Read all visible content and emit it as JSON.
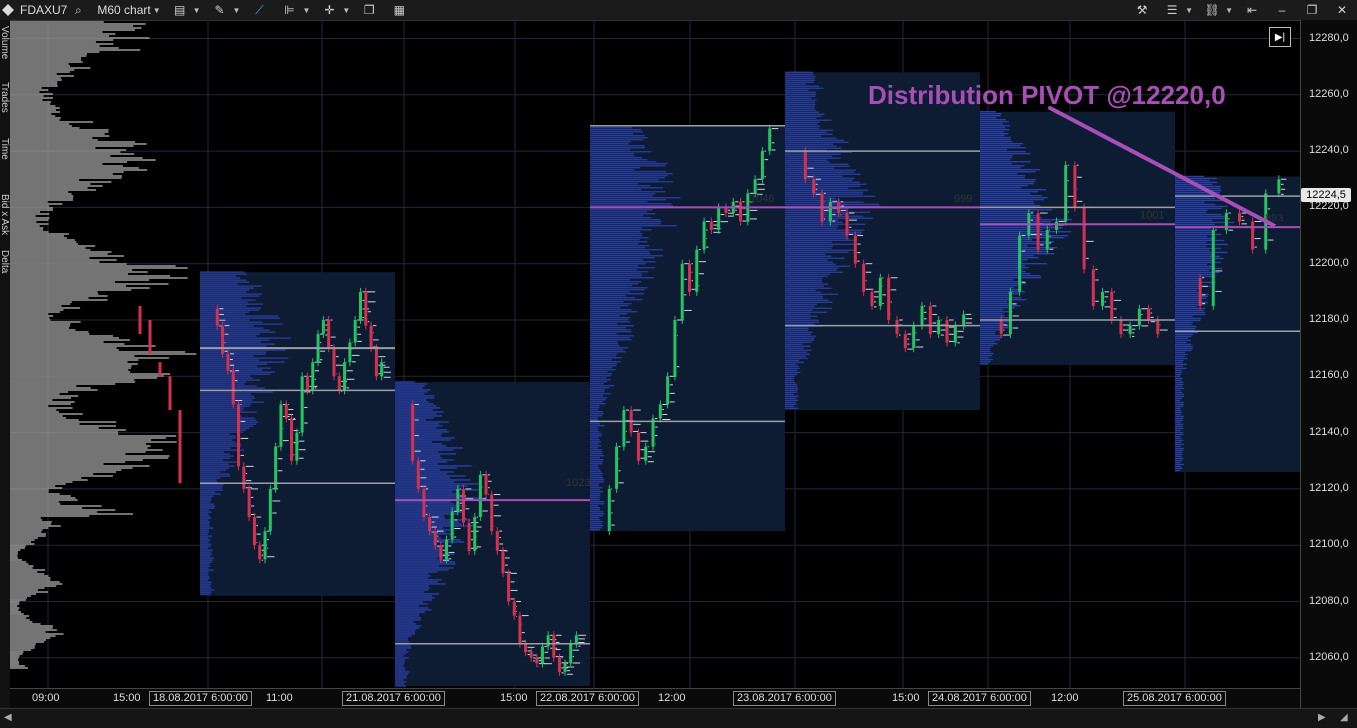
{
  "toolbar": {
    "symbol": "FDAXU7",
    "timeframe": "M60 chart",
    "icons": [
      "search-icon",
      "chart-type-icon",
      "pencil-icon",
      "line-chart-icon",
      "indicators-icon",
      "crosshair-icon",
      "window-icon",
      "template-icon"
    ],
    "right_icons": [
      "tools-icon",
      "layout-icon",
      "link-icon",
      "pin-icon",
      "restore-icon",
      "close-icon"
    ]
  },
  "left_strip_labels": [
    "Volume",
    "Trades",
    "Time",
    "Bid x Ask",
    "Delta"
  ],
  "colors": {
    "bull": "#22c55e",
    "bear": "#d6304f",
    "profile": "#2b3fa8",
    "profile_bg": "#0d1c33",
    "poc": "#9aa0a6",
    "vpoc": "#a74fb6",
    "annotation": "#a74fb6"
  },
  "y_axis": {
    "labels": [
      "12280,0",
      "12260,0",
      "12240,0",
      "12220,0",
      "12200,0",
      "12180,0",
      "12160,0",
      "12140,0",
      "12120,0",
      "12100,0",
      "12080,0",
      "12060,0"
    ],
    "current_price": "12224,5"
  },
  "x_axis": {
    "labels": [
      {
        "text": "09:00",
        "boxed": false
      },
      {
        "text": "15:00",
        "boxed": false
      },
      {
        "text": "18.08.2017 6:00:00",
        "boxed": true
      },
      {
        "text": "11:00",
        "boxed": false
      },
      {
        "text": "21.08.2017 6:00:00",
        "boxed": true
      },
      {
        "text": "15:00",
        "boxed": false
      },
      {
        "text": "22.08.2017 6:00:00",
        "boxed": true
      },
      {
        "text": "12:00",
        "boxed": false
      },
      {
        "text": "23.08.2017 6:00:00",
        "boxed": true
      },
      {
        "text": "15:00",
        "boxed": false
      },
      {
        "text": "24.08.2017 6:00:00",
        "boxed": true
      },
      {
        "text": "12:00",
        "boxed": false
      },
      {
        "text": "25.08.2017 6:00:00",
        "boxed": true
      }
    ]
  },
  "annotation": "Distribution PIVOT @12220,0",
  "profile_volume_labels": [
    "1023",
    "1046",
    "999",
    "1001",
    "893"
  ]
}
